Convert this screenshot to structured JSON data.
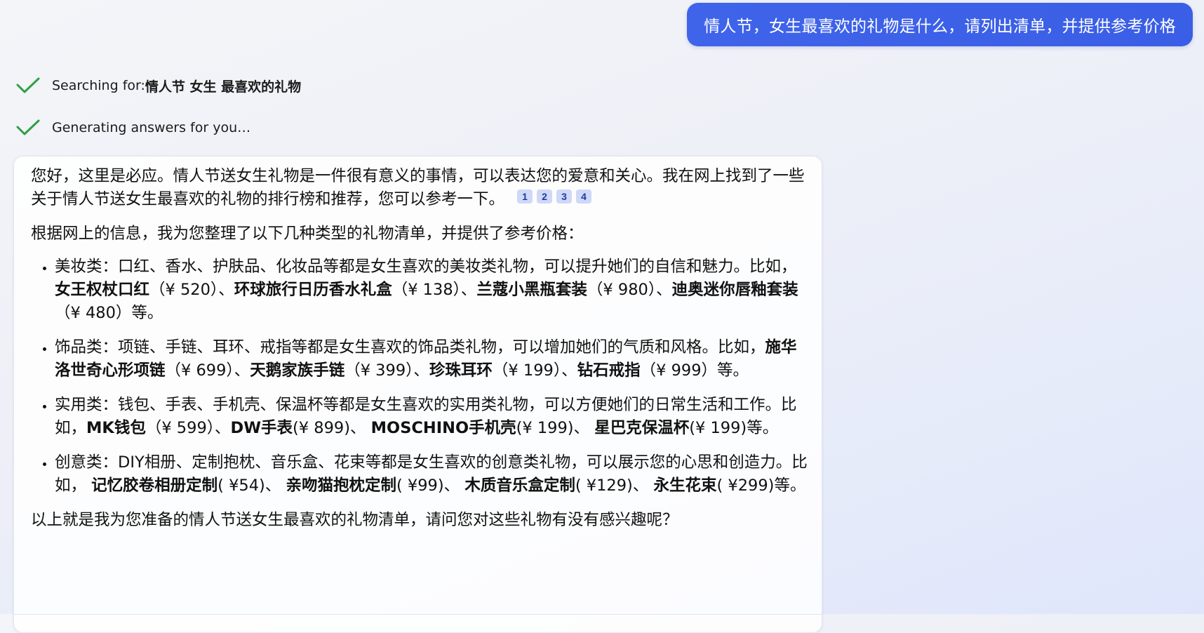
{
  "user_message": "情人节，女生最喜欢的礼物是什么，请列出清单，并提供参考价格",
  "progress": {
    "search_prefix": "Searching for: ",
    "search_query": "情人节 女生 最喜欢的礼物",
    "generating": "Generating answers for you…",
    "check_color": "#2ea043"
  },
  "answer": {
    "intro": "您好，这里是必应。情人节送女生礼物是一件很有意义的事情，可以表达您的爱意和关心。我在网上找到了一些关于情人节送女生最喜欢的礼物的排行榜和推荐，您可以参考一下。",
    "citations": [
      "1",
      "2",
      "3",
      "4"
    ],
    "lead": "根据网上的信息，我为您整理了以下几种类型的礼物清单，并提供了参考价格：",
    "categories": [
      {
        "desc": "美妆类：口红、香水、护肤品、化妆品等都是女生喜欢的美妆类礼物，可以提升她们的自信和魅力。比如，",
        "items": [
          {
            "name": "女王权杖口红",
            "price": "（¥ 520）",
            "sep": "、"
          },
          {
            "name": "环球旅行日历香水礼盒",
            "price": "（¥ 138）",
            "sep": "、"
          },
          {
            "name": "兰蔻小黑瓶套装",
            "price": "（¥ 980）",
            "sep": "、"
          },
          {
            "name": "迪奥迷你唇釉套装",
            "price": "（¥ 480）",
            "sep": ""
          }
        ],
        "end": "等。"
      },
      {
        "desc": "饰品类：项链、手链、耳环、戒指等都是女生喜欢的饰品类礼物，可以增加她们的气质和风格。比如，",
        "items": [
          {
            "name": "施华洛世奇心形项链",
            "price": "（¥ 699）",
            "sep": "、"
          },
          {
            "name": "天鹅家族手链",
            "price": "（¥ 399）",
            "sep": "、"
          },
          {
            "name": "珍珠耳环",
            "price": "（¥ 199）",
            "sep": "、"
          },
          {
            "name": "钻石戒指",
            "price": "（¥ 999）",
            "sep": ""
          }
        ],
        "end": "等。"
      },
      {
        "desc": "实用类：钱包、手表、手机壳、保温杯等都是女生喜欢的实用类礼物，可以方便她们的日常生活和工作。比如，",
        "items": [
          {
            "name": "MK钱包",
            "price": "（¥ 599）",
            "sep": "、"
          },
          {
            "name": "DW手表",
            "price": "(¥ 899)",
            "sep": "、 "
          },
          {
            "name": "MOSCHINO手机壳",
            "price": "(¥ 199)",
            "sep": "、 "
          },
          {
            "name": "星巴克保温杯",
            "price": "(¥ 199)",
            "sep": ""
          }
        ],
        "end": "等。"
      },
      {
        "desc": "创意类：DIY相册、定制抱枕、音乐盒、花束等都是女生喜欢的创意类礼物，可以展示您的心思和创造力。比如， ",
        "items": [
          {
            "name": "记忆胶卷相册定制",
            "price": "( ¥54)",
            "sep": "、 "
          },
          {
            "name": "亲吻猫抱枕定制",
            "price": "( ¥99)",
            "sep": "、 "
          },
          {
            "name": "木质音乐盒定制",
            "price": "( ¥129)",
            "sep": "、 "
          },
          {
            "name": "永生花束",
            "price": "( ¥299)",
            "sep": ""
          }
        ],
        "end": "等。"
      }
    ],
    "closing": "以上就是我为您准备的情人节送女生最喜欢的礼物清单，请问您对这些礼物有没有感兴趣呢？"
  }
}
